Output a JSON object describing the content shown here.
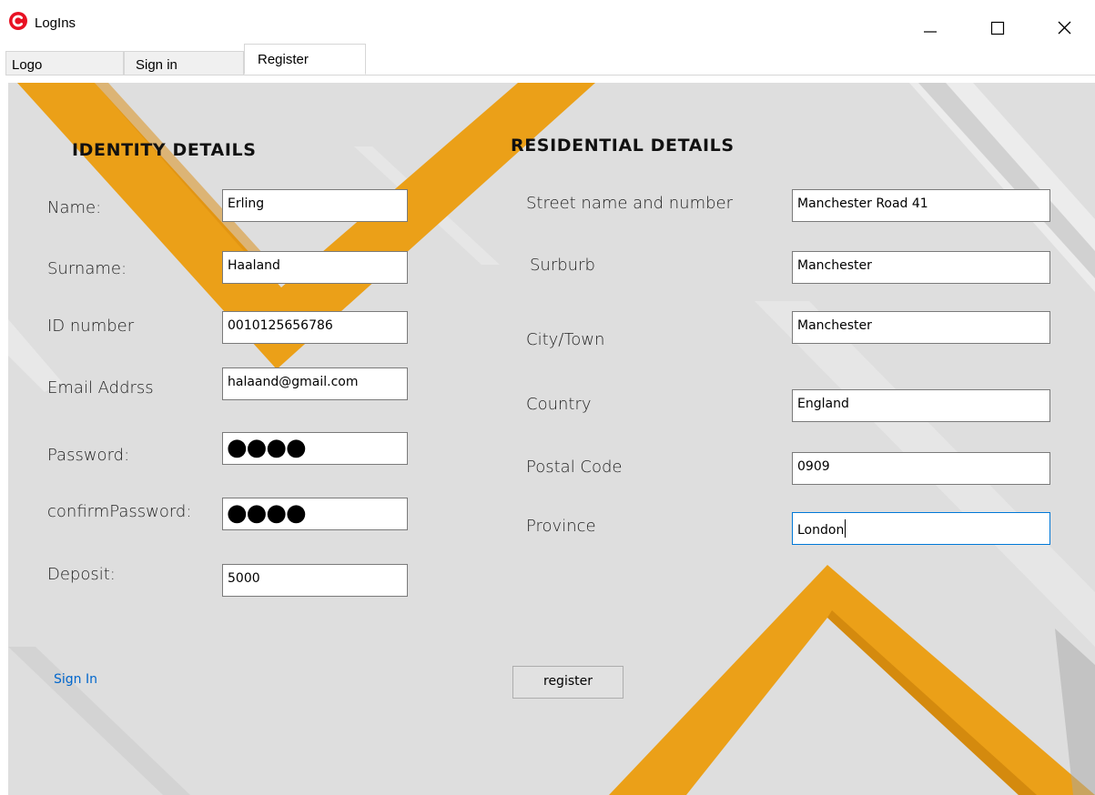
{
  "window": {
    "title": "LogIns",
    "accent": "#e81123"
  },
  "tabs": [
    {
      "label": "Logo"
    },
    {
      "label": "Sign in"
    },
    {
      "label": "Register"
    }
  ],
  "identity": {
    "heading": "IDENTITY DETAILS",
    "fields": {
      "name": {
        "label": "Name:",
        "value": "Erling"
      },
      "surname": {
        "label": "Surname:",
        "value": "Haaland"
      },
      "id": {
        "label": "ID number",
        "value": "0010125656786"
      },
      "email": {
        "label": "Email Addrss",
        "value": "halaand@gmail.com"
      },
      "password": {
        "label": "Password:",
        "value": "●●●●"
      },
      "confirm": {
        "label": "confirmPassword:",
        "value": "●●●●"
      },
      "deposit": {
        "label": "Deposit:",
        "value": "5000"
      }
    }
  },
  "residential": {
    "heading": "RESIDENTIAL DETAILS",
    "fields": {
      "street": {
        "label": "Street name and number",
        "value": "Manchester Road 41"
      },
      "suburb": {
        "label": "Surburb",
        "value": "Manchester"
      },
      "city": {
        "label": "City/Town",
        "value": "Manchester"
      },
      "country": {
        "label": "Country",
        "value": "England"
      },
      "postal": {
        "label": "Postal Code",
        "value": "0909"
      },
      "province": {
        "label": "Province",
        "value": "London"
      }
    }
  },
  "actions": {
    "signin_link": "Sign In",
    "register_button": "register"
  },
  "colors": {
    "panel_bg": "#dedede",
    "stripe_orange": "#eba018",
    "link_blue": "#0066cc",
    "focus_blue": "#0078d7"
  }
}
